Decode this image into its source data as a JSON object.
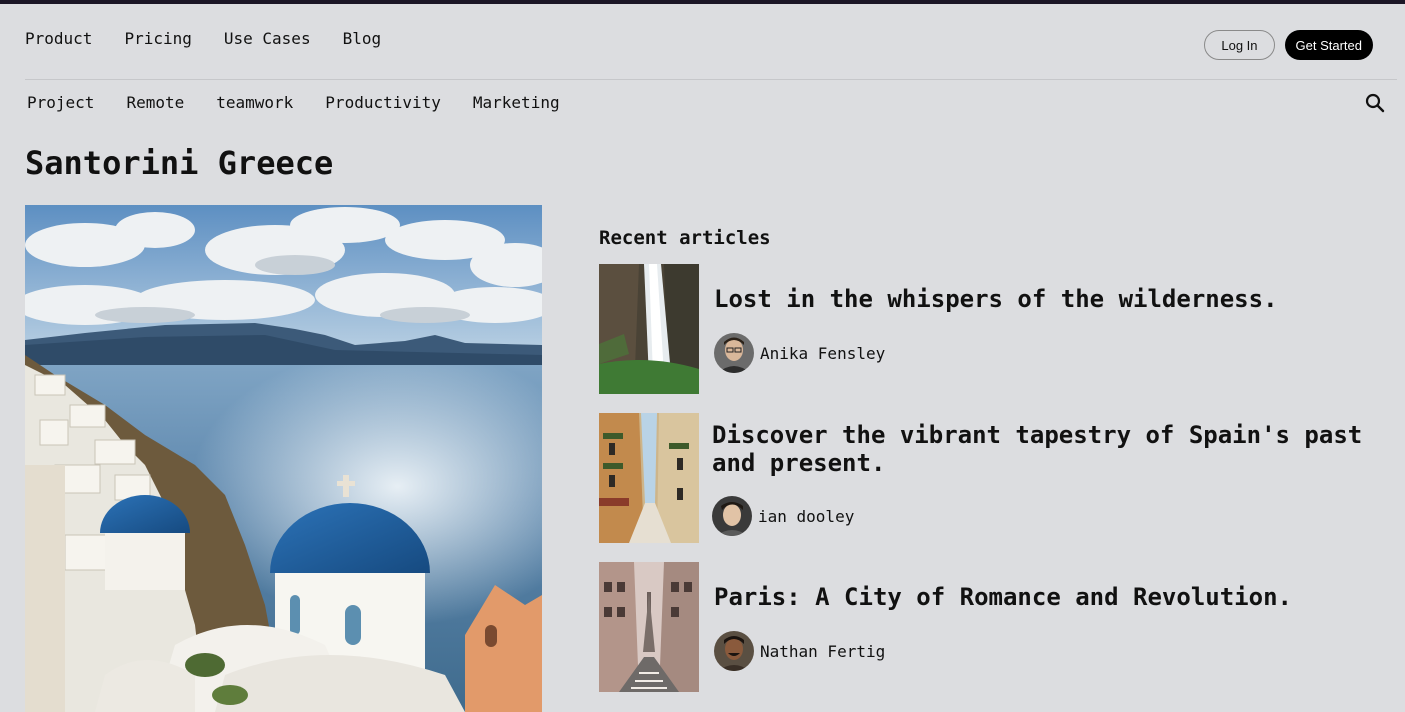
{
  "top_nav": {
    "items": [
      {
        "label": "Product"
      },
      {
        "label": "Pricing"
      },
      {
        "label": "Use Cases"
      },
      {
        "label": "Blog"
      }
    ],
    "login_label": "Log In",
    "get_started_label": "Get Started"
  },
  "category_nav": {
    "items": [
      {
        "label": "Project"
      },
      {
        "label": "Remote"
      },
      {
        "label": "teamwork"
      },
      {
        "label": "Productivity"
      },
      {
        "label": "Marketing"
      }
    ],
    "search_icon": "search-icon"
  },
  "page_title": "Santorini Greece",
  "recent": {
    "heading": "Recent articles",
    "articles": [
      {
        "title": "Lost in the whispers of the wilderness.",
        "author": "Anika Fensley",
        "thumb": "waterfall"
      },
      {
        "title": "Discover the vibrant tapestry of Spain's past and present.",
        "author": "ian dooley",
        "thumb": "street"
      },
      {
        "title": "Paris: A City of Romance and Revolution.",
        "author": "Nathan Fertig",
        "thumb": "paris-street"
      }
    ]
  },
  "colors": {
    "background": "#dcdde0",
    "text": "#111111",
    "primary_button": "#000000",
    "dome_blue": "#1f5fa0"
  }
}
